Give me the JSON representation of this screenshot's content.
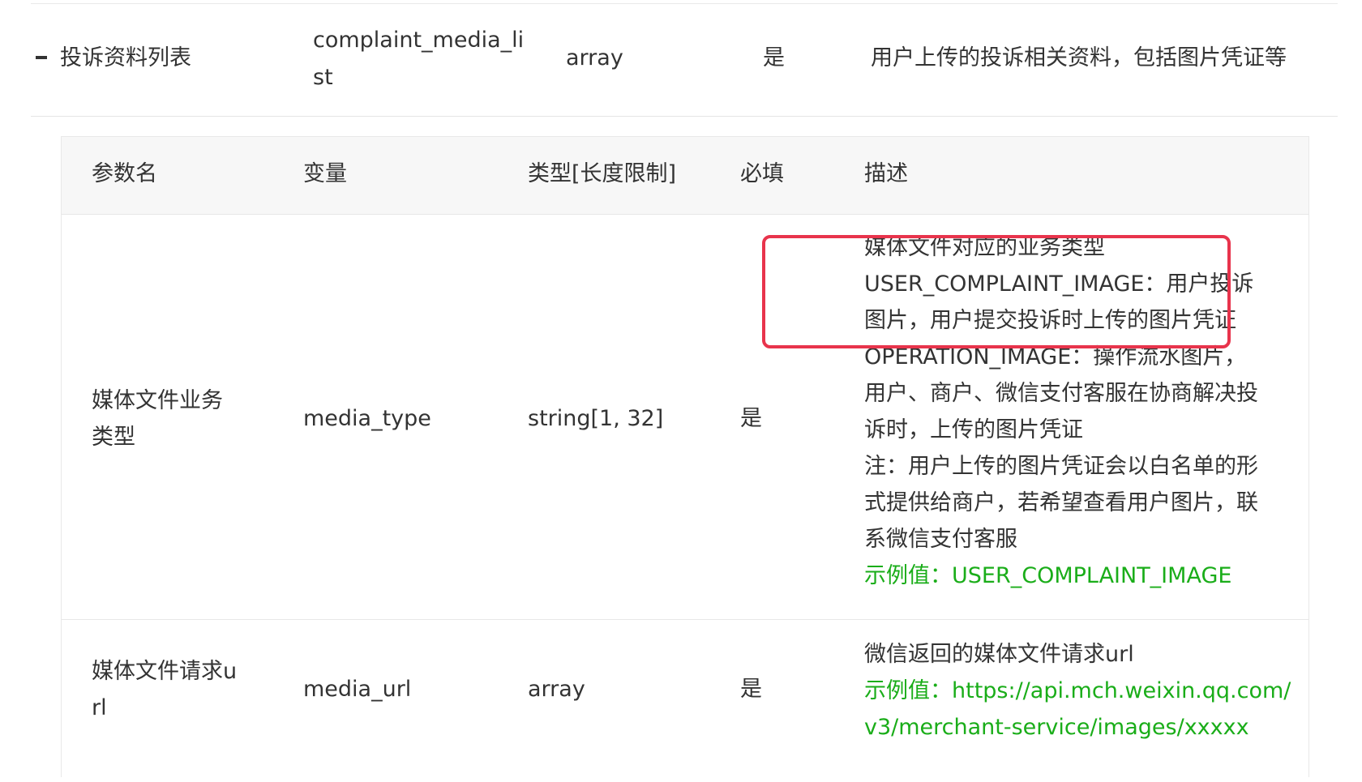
{
  "parent_row": {
    "name": "投诉资料列表",
    "variable": "complaint_media_list",
    "type": "array",
    "required": "是",
    "description": "用户上传的投诉相关资料，包括图片凭证等"
  },
  "sub_table": {
    "headers": [
      "参数名",
      "变量",
      "类型[长度限制]",
      "必填",
      "描述"
    ],
    "rows": [
      {
        "name": [
          "媒体文件业务",
          "类型"
        ],
        "variable": "media_type",
        "type": "string[1, 32]",
        "required": "是",
        "description_lines": [
          "媒体文件对应的业务类型",
          "USER_COMPLAINT_IMAGE：用户投诉",
          "图片，用户提交投诉时上传的图片凭证",
          "OPERATION_IMAGE：操作流水图片，",
          "用户、商户、微信支付客服在协商解决投",
          "诉时，上传的图片凭证"
        ],
        "note_lines": [
          "注：用户上传的图片凭证会以白名单的形",
          "式提供给商户，若希望查看用户图片，联",
          "系微信支付客服"
        ],
        "example_lines": [
          "示例值：USER_COMPLAINT_IMAGE"
        ]
      },
      {
        "name": [
          "媒体文件请求u",
          "rl"
        ],
        "variable": "media_url",
        "type": "array",
        "required": "是",
        "description_lines": [
          "微信返回的媒体文件请求url"
        ],
        "example_lines": [
          "示例值：https://api.mch.weixin.qq.com/",
          "v3/merchant-service/images/xxxxx"
        ]
      }
    ]
  },
  "colors": {
    "text": "#333333",
    "example": "#1aad19",
    "highlight_box": "#e8344c",
    "header_bg": "#f7f7f7"
  },
  "icons": {
    "collapse_toggle": "minus-icon"
  }
}
